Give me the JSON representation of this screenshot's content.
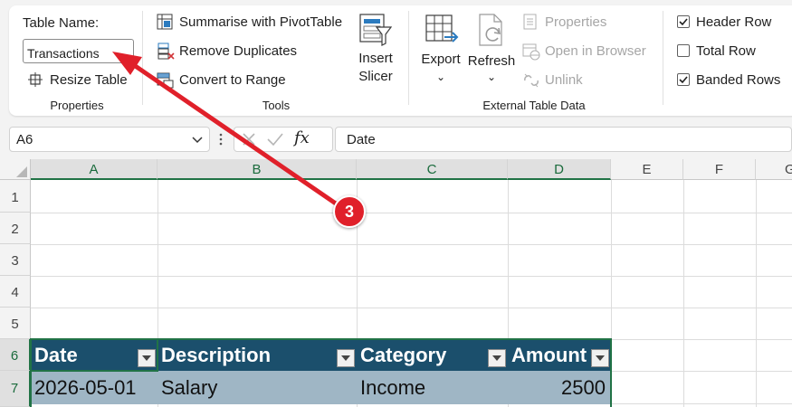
{
  "ribbon": {
    "properties": {
      "table_name_label": "Table Name:",
      "table_name_value": "Transactions",
      "resize_table": "Resize Table",
      "group_label": "Properties"
    },
    "tools": {
      "summarise_pivot": "Summarise with PivotTable",
      "remove_duplicates": "Remove Duplicates",
      "convert_to_range": "Convert to Range",
      "insert_slicer_line1": "Insert",
      "insert_slicer_line2": "Slicer",
      "group_label": "Tools"
    },
    "external": {
      "export": "Export",
      "refresh": "Refresh",
      "properties": "Properties",
      "open_in_browser": "Open in Browser",
      "unlink": "Unlink",
      "group_label": "External Table Data"
    },
    "style_options": {
      "header_row": {
        "label": "Header Row",
        "checked": true
      },
      "total_row": {
        "label": "Total Row",
        "checked": false
      },
      "banded_rows": {
        "label": "Banded Rows",
        "checked": true
      }
    }
  },
  "formula_bar": {
    "name_box": "A6",
    "fx": "fx",
    "content": "Date"
  },
  "grid": {
    "columns": [
      "A",
      "B",
      "C",
      "D",
      "E",
      "F",
      "G"
    ],
    "rows": [
      "1",
      "2",
      "3",
      "4",
      "5",
      "6",
      "7"
    ]
  },
  "table": {
    "headers": [
      "Date",
      "Description",
      "Category",
      "Amount"
    ],
    "row1": [
      "2026-05-01",
      "Salary",
      "Income",
      "2500"
    ]
  },
  "annotation": {
    "step": "3"
  },
  "colors": {
    "table_header": "#1b4f6c",
    "table_band": "#9fb6c5",
    "excel_green": "#217346",
    "annotation_red": "#e0202a"
  }
}
